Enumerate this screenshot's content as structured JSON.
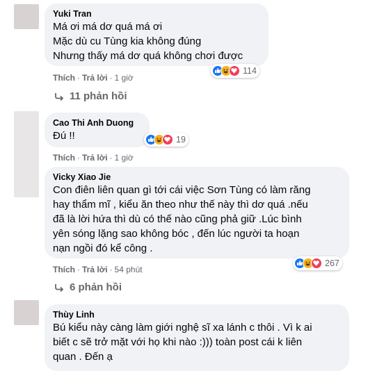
{
  "colors": {
    "like": "#1877f2",
    "haha": "#f7b125",
    "love": "#f33e58",
    "bubble": "#f0f2f5",
    "muted": "#65676b"
  },
  "comments": [
    {
      "author": "Yuki Tran",
      "text": "Má ơi má dơ quá má ơi\nMặc dù cu Tùng kia không đúng\nNhưng thấy má dơ quá không chơi được",
      "like": "Thích",
      "reply": "Trả lời",
      "time": "1 giờ",
      "reactions": [
        "like-icon",
        "haha-icon",
        "love-icon"
      ],
      "reaction_count": "114",
      "replies": "11 phản hồi"
    },
    {
      "author": "Cao Thi Anh Duong",
      "text": "Đú !!",
      "like": "Thích",
      "reply": "Trả lời",
      "time": "1 giờ",
      "reactions": [
        "like-icon",
        "haha-icon",
        "love-icon"
      ],
      "reaction_count": "19"
    },
    {
      "author": "Vicky Xiao Jie",
      "text": "Con điên liên quan gì tới cái việc Sơn Tùng có làm răng\nhay thẩm mĩ , kiểu ăn theo như thế này thì dơ quá .nếu\nđã là lời hứa thì dù có thế nào cũng phả giữ .Lúc bình\nyên sóng lặng sao không bóc , đến lúc người ta hoạn\nnạn ngồi đó kể công .",
      "like": "Thích",
      "reply": "Trả lời",
      "time": "54 phút",
      "reactions": [
        "like-icon",
        "haha-icon",
        "love-icon"
      ],
      "reaction_count": "267",
      "replies": "6 phản hồi"
    },
    {
      "author": "Thùy Linh",
      "text": "Bú kiểu này càng làm giới nghệ sĩ xa lánh c thôi . Vì k ai\nbiết c sẽ trở mặt với họ khi nào :))) toàn post cái k liên\nquan . Đến ạ"
    }
  ]
}
